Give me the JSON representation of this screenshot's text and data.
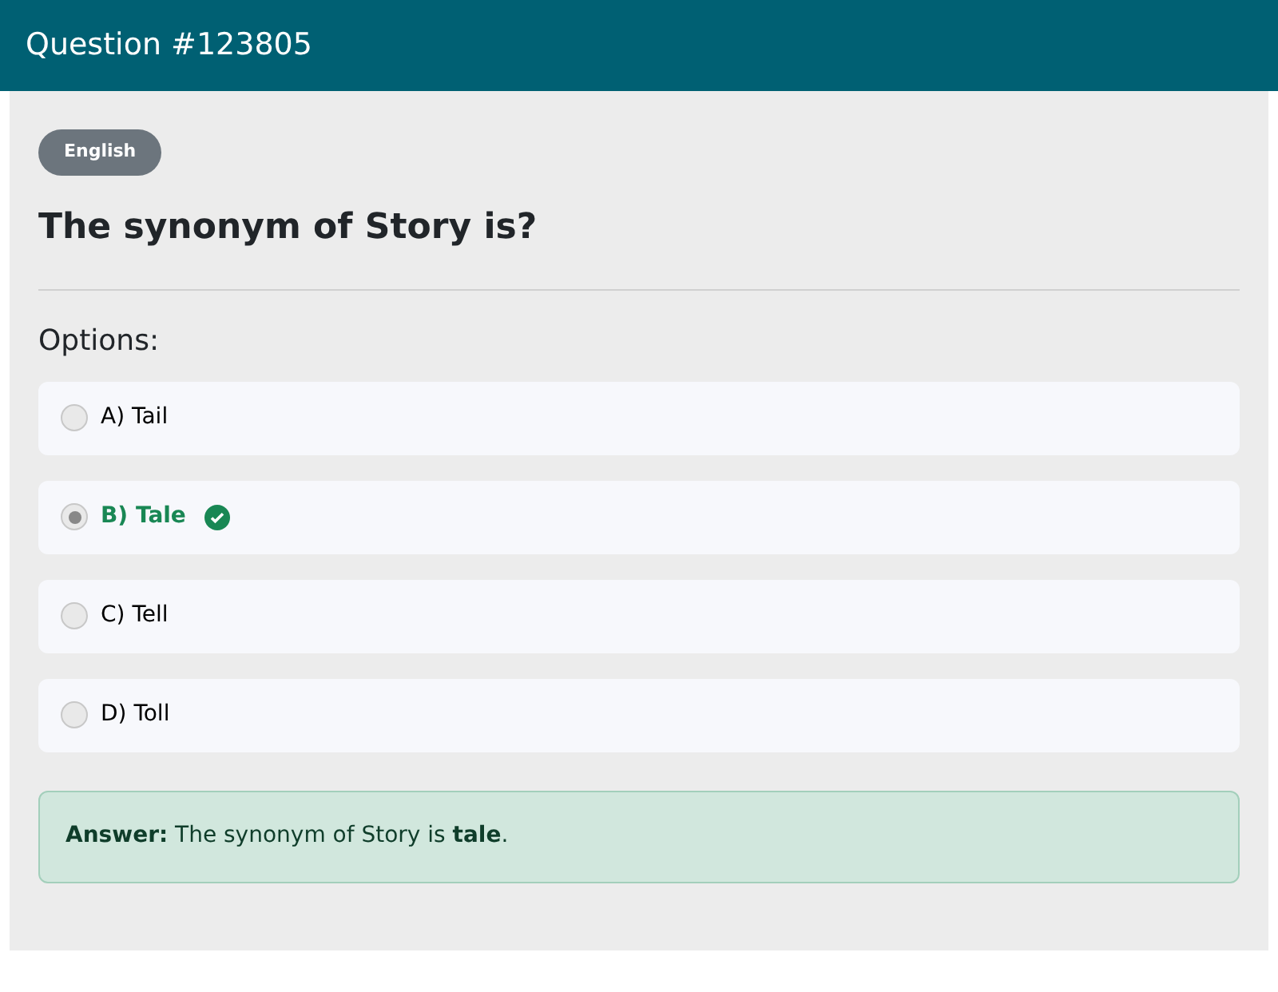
{
  "header": {
    "title": "Question #123805"
  },
  "category": "English",
  "question": "The synonym of Story is?",
  "options_label": "Options:",
  "options": [
    {
      "label": "A) Tail",
      "selected": false,
      "correct": false
    },
    {
      "label": "B) Tale",
      "selected": true,
      "correct": true
    },
    {
      "label": "C) Tell",
      "selected": false,
      "correct": false
    },
    {
      "label": "D) Toll",
      "selected": false,
      "correct": false
    }
  ],
  "answer": "**Answer:** The synonym of Story is **tale**."
}
